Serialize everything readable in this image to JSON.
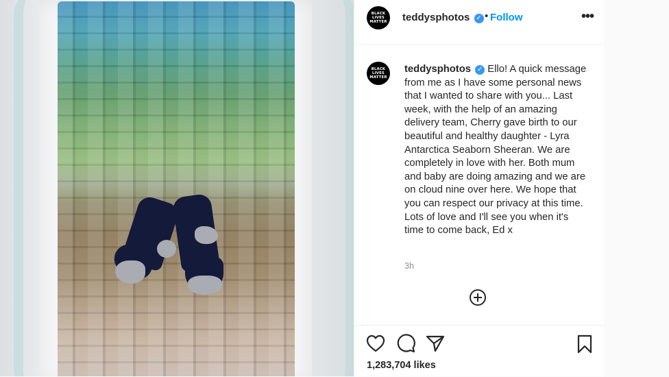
{
  "post": {
    "username": "teddysphotos",
    "verified_badge": "✓",
    "separator": "•",
    "follow_label": "Follow",
    "more_label": "•••",
    "avatar_text": [
      "BLACK",
      "LIVES",
      "MATTER"
    ],
    "caption": "Ello! A quick message from me as I have some personal news that I wanted to share with you... Last week, with the help of an amazing delivery team, Cherry gave birth to our beautiful and healthy daughter - Lyra Antarctica Seaborn Sheeran. We are completely in love with her. Both mum and baby are doing amazing and we are on cloud nine over here. We hope that you can respect our privacy at this time. Lots of love and I'll see you when it's time to come back, Ed x",
    "time_ago": "3h",
    "likes": "1,283,704 likes"
  },
  "icons": {
    "like": "heart-icon",
    "comment": "comment-icon",
    "share": "share-icon",
    "save": "bookmark-icon",
    "add": "add-comment-icon"
  },
  "colors": {
    "accent": "#0095f6",
    "verified": "#3897f0",
    "text": "#262626",
    "muted": "#8e8e8e"
  }
}
